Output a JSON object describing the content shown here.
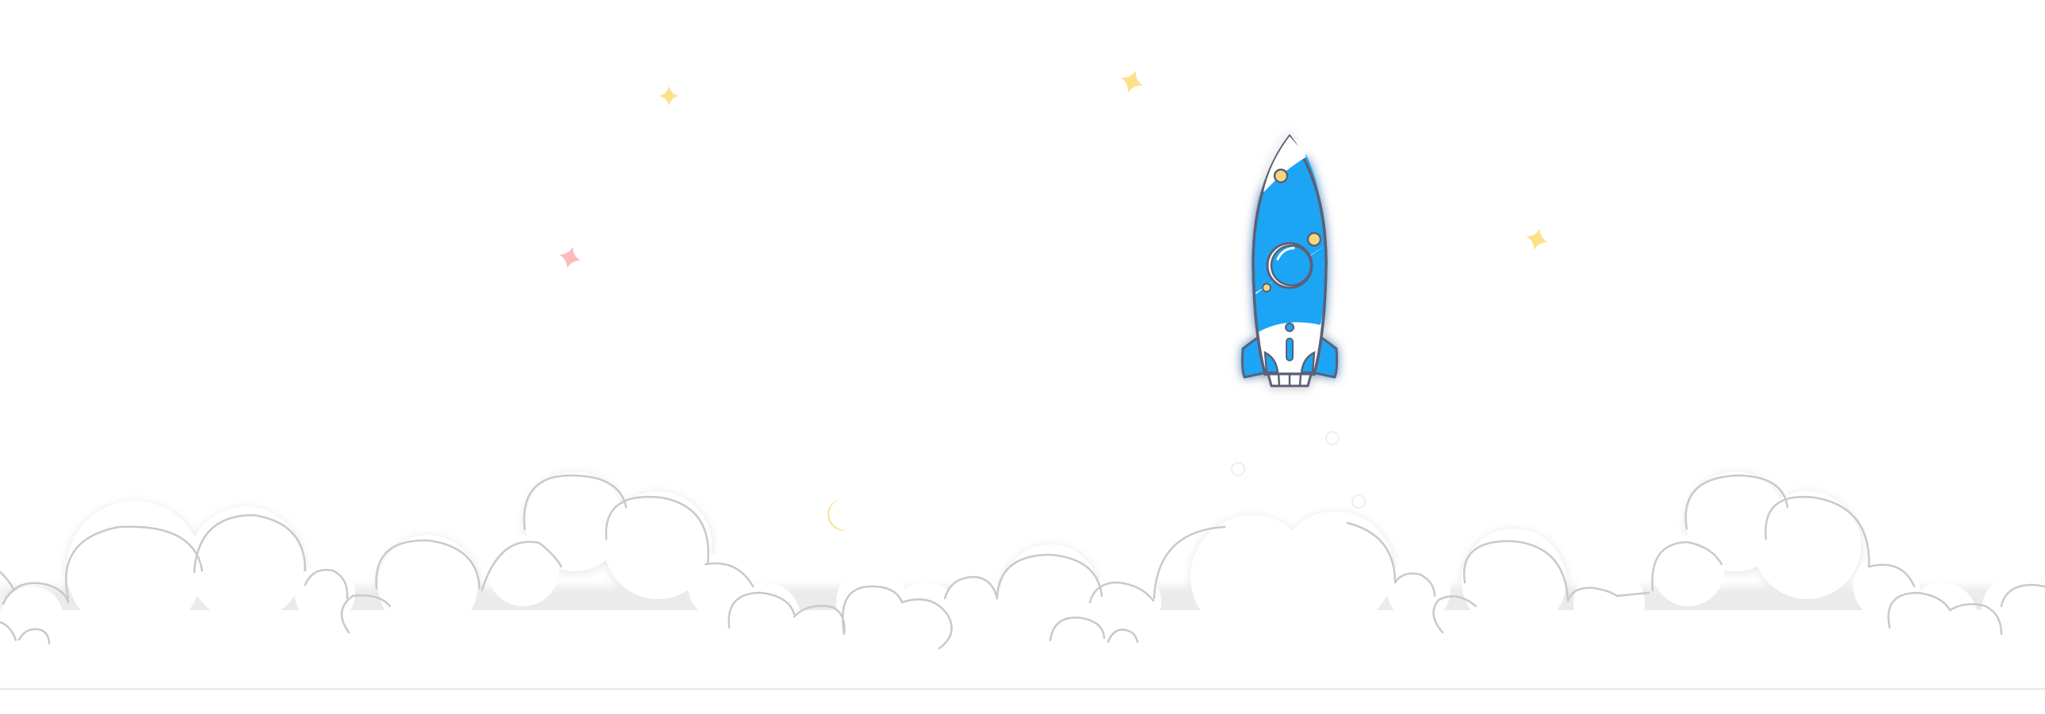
{
  "scene": {
    "description_free": true,
    "colors": {
      "rocket_blue": "#1ea5f4",
      "rocket_outline": "#5b6177",
      "rocket_white": "#ffffff",
      "porthole_gold": "#f7d77e",
      "glow": "#9aa3ff",
      "cloud_fill": "#ffffff",
      "cloud_stroke": "#d8d8d8",
      "cloud_shadow": "#e6e6e6",
      "star_yellow": "#fde18a",
      "star_pink": "#fbbcbc",
      "moon_yellow": "#fcd97a",
      "moon_lime": "#e8f56a",
      "moon_pink": "#f8a5a5"
    },
    "icons": [
      "rocket-icon",
      "star-icon",
      "moon-icon",
      "cloud-icon"
    ]
  }
}
